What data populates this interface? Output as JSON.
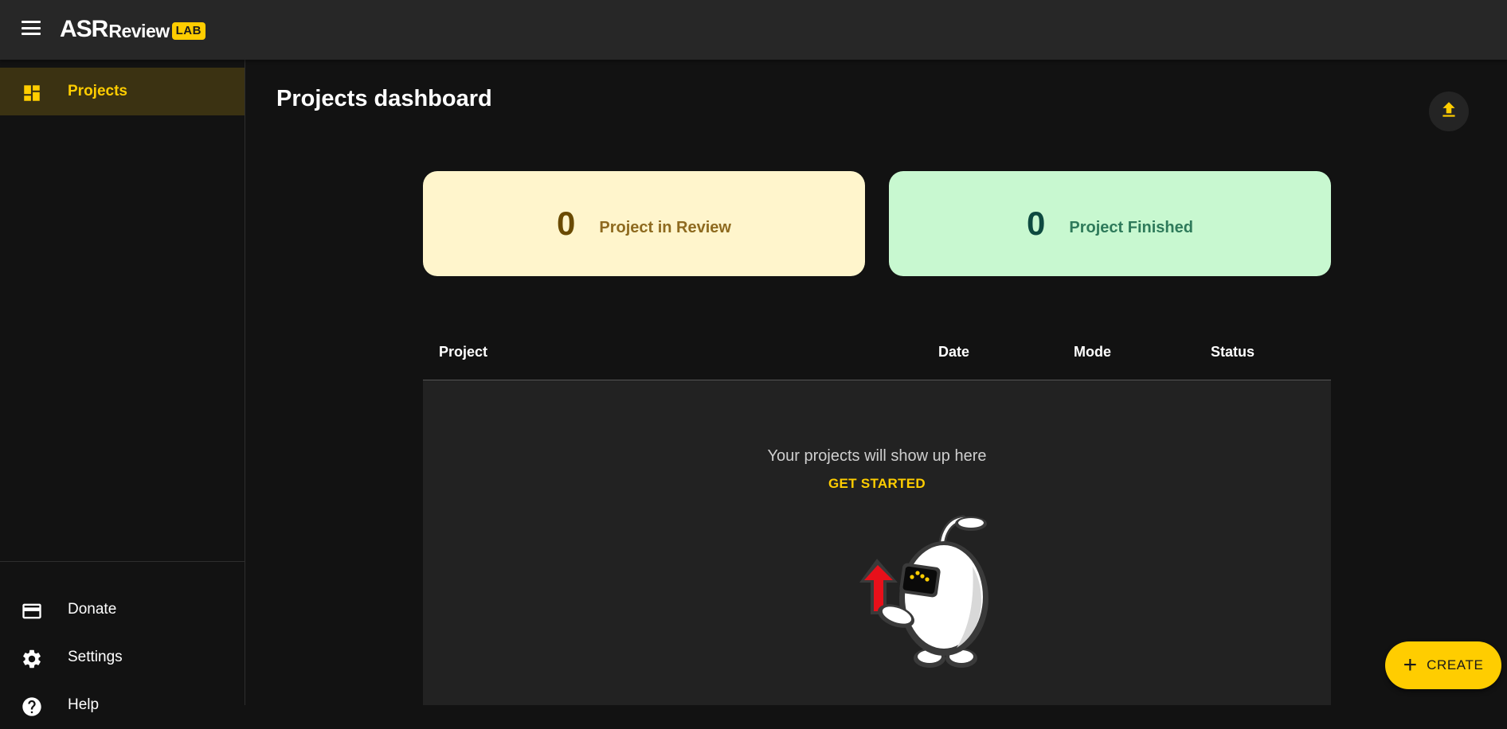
{
  "app": {
    "logo_main": "ASR",
    "logo_sub": "eview",
    "logo_badge": "LAB"
  },
  "sidebar": {
    "items": [
      {
        "label": "Projects",
        "icon": "dashboard-icon",
        "active": true
      },
      {
        "label": "Donate",
        "icon": "credit-card-icon"
      },
      {
        "label": "Settings",
        "icon": "gear-icon"
      },
      {
        "label": "Help",
        "icon": "help-icon"
      }
    ]
  },
  "main": {
    "title": "Projects dashboard",
    "upload_icon": "upload-icon",
    "stats": [
      {
        "count": "0",
        "label": "Project in Review",
        "color": "#FFF5CC"
      },
      {
        "count": "0",
        "label": "Project Finished",
        "color": "#C8F8D0"
      }
    ],
    "table": {
      "columns": [
        "Project",
        "Date",
        "Mode",
        "Status"
      ],
      "empty_message": "Your projects will show up here",
      "cta": "GET STARTED"
    }
  },
  "fab": {
    "label": "CREATE",
    "icon": "plus-icon"
  },
  "colors": {
    "accent": "#FFCD00",
    "background": "#121212",
    "appbar": "#272727"
  }
}
